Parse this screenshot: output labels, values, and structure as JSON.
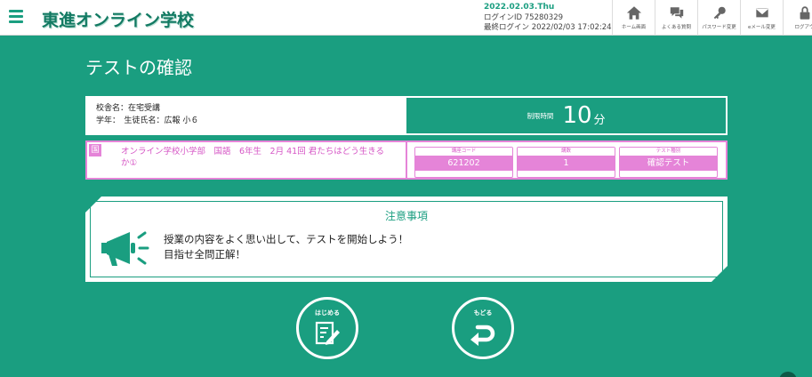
{
  "header": {
    "logo": "東進オンライン学校",
    "date": "2022.02.03.Thu",
    "login_id": "ログインID 75280329",
    "last_login": "最終ログイン 2022/02/03 17:02:24",
    "nav": [
      {
        "icon": "home-icon",
        "label": "ホーム画面"
      },
      {
        "icon": "faq-chat-icon",
        "label": "よくある質問"
      },
      {
        "icon": "key-icon",
        "label": "パスワード変更"
      },
      {
        "icon": "mail-icon",
        "label": "eメール変更"
      },
      {
        "icon": "lock-icon",
        "label": "ログアウ"
      }
    ]
  },
  "page": {
    "title": "テストの確認"
  },
  "student": {
    "school": "校舎名：在宅受講",
    "grade_name": "学年：　生徒氏名：広報 小６"
  },
  "time": {
    "label": "制限時間",
    "value": "10",
    "unit": "分"
  },
  "course": {
    "subject": "国",
    "title": "オンライン学校小学部　国語　6年生　2月 41回 君たちはどう生きるか①",
    "fields": [
      {
        "label": "講座コード",
        "value": "621202"
      },
      {
        "label": "講数",
        "value": "1"
      },
      {
        "label": "テスト種別",
        "value": "確認テスト"
      }
    ]
  },
  "notice": {
    "title": "注意事項",
    "line1": "授業の内容をよく思い出して、テストを開始しよう！",
    "line2": "目指せ全問正解！"
  },
  "buttons": {
    "start": "はじめる",
    "back": "もどる"
  },
  "colors": {
    "brand": "#1a9e80",
    "pink": "#e584d8"
  }
}
